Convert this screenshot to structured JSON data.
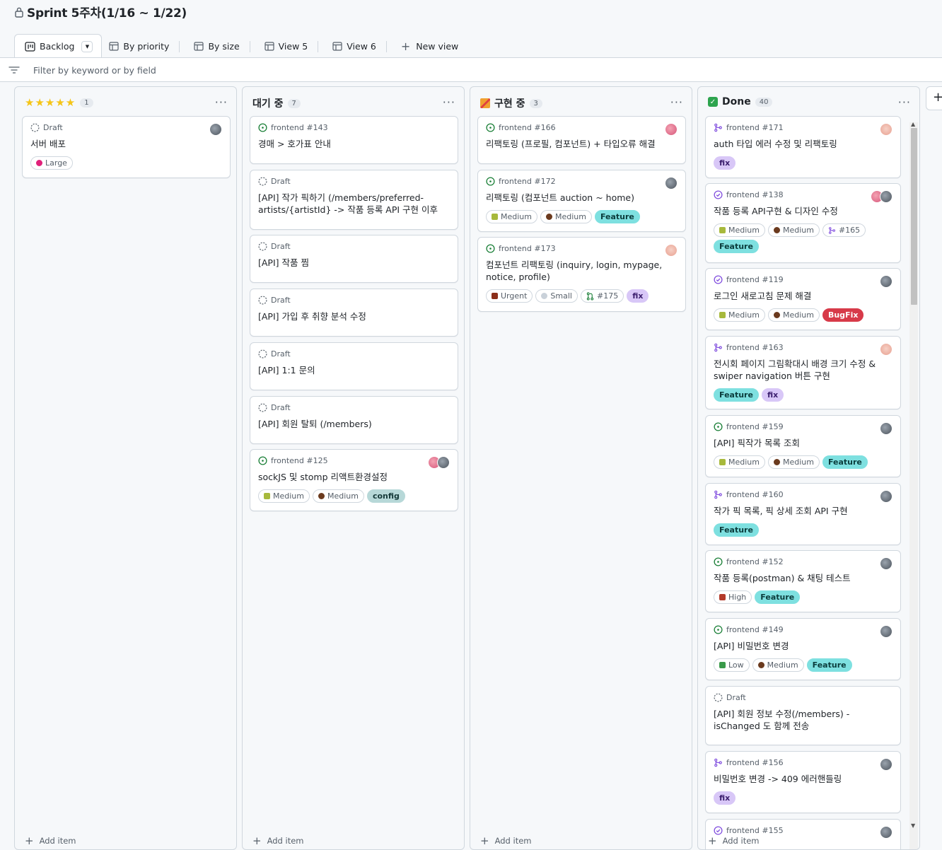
{
  "project": {
    "title": "Sprint 5주차(1/16 ~ 1/22)"
  },
  "tabs": [
    {
      "label": "Backlog"
    },
    {
      "label": "By priority"
    },
    {
      "label": "By size"
    },
    {
      "label": "View 5"
    },
    {
      "label": "View 6"
    },
    {
      "label": "New view"
    }
  ],
  "filter": {
    "placeholder": "Filter by keyword or by field"
  },
  "add_item_label": "Add item",
  "columns": [
    {
      "name": "",
      "icon": "five-stars",
      "count": "1",
      "cards": [
        {
          "meta": "Draft",
          "status": "draft",
          "title": "서버 배포",
          "labels": [
            {
              "text": "Large",
              "kind": "size"
            }
          ],
          "avatar": "gray"
        }
      ]
    },
    {
      "name": "대기 중",
      "count": "7",
      "cards": [
        {
          "meta": "frontend #143",
          "status": "open",
          "title": "경매 > 호가표 안내",
          "labels": []
        },
        {
          "meta": "Draft",
          "status": "draft",
          "title": "[API] 작가 픽하기 (/members/preferred-artists/{artistId} -> 작품 등록 API 구현 이후",
          "labels": []
        },
        {
          "meta": "Draft",
          "status": "draft",
          "title": "[API] 작품 찜",
          "labels": []
        },
        {
          "meta": "Draft",
          "status": "draft",
          "title": "[API] 가입 후 취향 분석 수정",
          "labels": []
        },
        {
          "meta": "Draft",
          "status": "draft",
          "title": "[API] 1:1 문의",
          "labels": []
        },
        {
          "meta": "Draft",
          "status": "draft",
          "title": "[API] 회원 탈퇴 (/members)",
          "labels": []
        },
        {
          "meta": "frontend #125",
          "status": "open",
          "title": "sockJS 및 stomp 리액트환경설정",
          "labels": [
            {
              "text": "Medium",
              "kind": "priority"
            },
            {
              "text": "Medium",
              "kind": "size"
            },
            {
              "text": "config",
              "kind": "config"
            }
          ],
          "avatar": "double"
        }
      ]
    },
    {
      "name": "구현 중",
      "count": "3",
      "cards": [
        {
          "meta": "frontend #166",
          "status": "open",
          "title": "리팩토링 (프로필, 컴포넌트) + 타입오류 해결",
          "labels": [],
          "avatar": "pink"
        },
        {
          "meta": "frontend #172",
          "status": "open",
          "title": "리팩토링 (컴포넌트 auction ~ home)",
          "labels": [
            {
              "text": "Medium",
              "kind": "priority"
            },
            {
              "text": "Medium",
              "kind": "size"
            },
            {
              "text": "Feature",
              "kind": "feature"
            }
          ],
          "avatar": "gray"
        },
        {
          "meta": "frontend #173",
          "status": "open",
          "title": "컴포넌트 리팩토링 (inquiry, login, mypage, notice, profile)",
          "labels": [
            {
              "text": "Urgent",
              "kind": "priority"
            },
            {
              "text": "Small",
              "kind": "size"
            },
            {
              "text": "#175",
              "kind": "pr"
            },
            {
              "text": "fix",
              "kind": "fix"
            }
          ],
          "avatar": "peach"
        }
      ]
    },
    {
      "name": "Done",
      "count": "40",
      "cards": [
        {
          "meta": "frontend #171",
          "status": "merged",
          "title": "auth 타입 에러 수정 및 리팩토링",
          "labels": [
            {
              "text": "fix",
              "kind": "fix"
            }
          ],
          "avatar": "peach"
        },
        {
          "meta": "frontend #138",
          "status": "closed",
          "title": "작품 등록 API구현 & 디자인 수정",
          "labels": [
            {
              "text": "Medium",
              "kind": "priority"
            },
            {
              "text": "Medium",
              "kind": "size"
            },
            {
              "text": "#165",
              "kind": "merged"
            },
            {
              "text": "Feature",
              "kind": "feature"
            }
          ],
          "avatar": "double"
        },
        {
          "meta": "frontend #119",
          "status": "closed",
          "title": "로그인 새로고침 문제 해결",
          "labels": [
            {
              "text": "Medium",
              "kind": "priority"
            },
            {
              "text": "Medium",
              "kind": "size"
            },
            {
              "text": "BugFix",
              "kind": "bugfix"
            }
          ],
          "avatar": "gray"
        },
        {
          "meta": "frontend #163",
          "status": "merged",
          "title": "전시회 페이지 그림확대시 배경 크기 수정 & swiper navigation 버튼 구현",
          "labels": [
            {
              "text": "Feature",
              "kind": "feature"
            },
            {
              "text": "fix",
              "kind": "fix"
            }
          ],
          "avatar": "peach"
        },
        {
          "meta": "frontend #159",
          "status": "open",
          "title": "[API] 픽작가 목록 조회",
          "labels": [
            {
              "text": "Medium",
              "kind": "priority"
            },
            {
              "text": "Medium",
              "kind": "size"
            },
            {
              "text": "Feature",
              "kind": "feature"
            }
          ],
          "avatar": "gray"
        },
        {
          "meta": "frontend #160",
          "status": "merged",
          "title": "작가 픽 목록, 픽 상세 조회 API 구현",
          "labels": [
            {
              "text": "Feature",
              "kind": "feature"
            }
          ],
          "avatar": "gray"
        },
        {
          "meta": "frontend #152",
          "status": "open",
          "title": "작품 등록(postman) & 채팅 테스트",
          "labels": [
            {
              "text": "High",
              "kind": "priority"
            },
            {
              "text": "Feature",
              "kind": "feature"
            }
          ],
          "avatar": "gray"
        },
        {
          "meta": "frontend #149",
          "status": "open",
          "title": "[API] 비밀번호 변경",
          "labels": [
            {
              "text": "Low",
              "kind": "priority"
            },
            {
              "text": "Medium",
              "kind": "size"
            },
            {
              "text": "Feature",
              "kind": "feature"
            }
          ],
          "avatar": "gray"
        },
        {
          "meta": "Draft",
          "status": "draft",
          "title": "[API] 회원 정보 수정(/members) - isChanged 도 함께 전송",
          "labels": []
        },
        {
          "meta": "frontend #156",
          "status": "merged",
          "title": "비밀번호 변경 -> 409 에러핸들링",
          "labels": [
            {
              "text": "fix",
              "kind": "fix"
            }
          ],
          "avatar": "gray"
        },
        {
          "meta": "frontend #155",
          "status": "closed",
          "title": "",
          "labels": [],
          "avatar": "gray"
        }
      ]
    }
  ]
}
